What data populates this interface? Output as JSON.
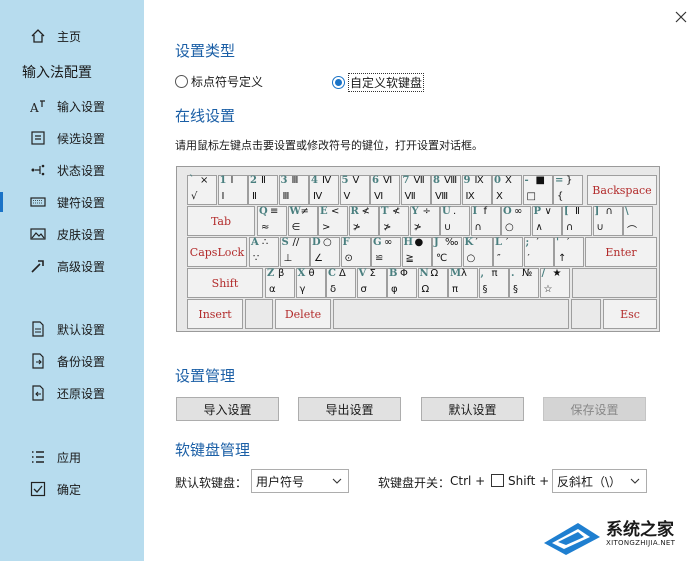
{
  "sidebar": {
    "home": "主页",
    "heading": "输入法配置",
    "items": [
      {
        "label": "输入设置",
        "icon": "input-settings-icon"
      },
      {
        "label": "候选设置",
        "icon": "candidate-icon"
      },
      {
        "label": "状态设置",
        "icon": "status-icon"
      },
      {
        "label": "键符设置",
        "icon": "keyboard-icon"
      },
      {
        "label": "皮肤设置",
        "icon": "image-icon"
      },
      {
        "label": "高级设置",
        "icon": "wrench-icon"
      },
      {
        "label": "默认设置",
        "icon": "document-icon"
      },
      {
        "label": "备份设置",
        "icon": "backup-icon"
      },
      {
        "label": "还原设置",
        "icon": "restore-icon"
      },
      {
        "label": "应用",
        "icon": "list-icon"
      },
      {
        "label": "确定",
        "icon": "checkbox-icon"
      }
    ],
    "active_index": 3,
    "accent": "#1a73c7",
    "background": "#b7dcee"
  },
  "settings_type": {
    "title": "设置类型",
    "option_punct": "标点符号定义",
    "option_custom": "自定义软键盘",
    "selected": "自定义软键盘"
  },
  "online": {
    "title": "在线设置",
    "description": "请用鼠标左键点击要设置或修改符号的键位，打开设置对话框。"
  },
  "keyboard": {
    "fn_color": "#b22b2b",
    "code_color": "#4a7f7f",
    "row1": [
      {
        "c": "`",
        "a": "×",
        "b": "√"
      },
      {
        "c": "1",
        "a": "Ⅰ",
        "b": "Ⅰ"
      },
      {
        "c": "2",
        "a": "Ⅱ",
        "b": "Ⅱ"
      },
      {
        "c": "3",
        "a": "Ⅲ",
        "b": "Ⅲ"
      },
      {
        "c": "4",
        "a": "Ⅳ",
        "b": "Ⅳ"
      },
      {
        "c": "5",
        "a": "Ⅴ",
        "b": "Ⅴ"
      },
      {
        "c": "6",
        "a": "Ⅵ",
        "b": "Ⅵ"
      },
      {
        "c": "7",
        "a": "Ⅶ",
        "b": "Ⅶ"
      },
      {
        "c": "8",
        "a": "Ⅷ",
        "b": "Ⅷ"
      },
      {
        "c": "9",
        "a": "Ⅸ",
        "b": "Ⅸ"
      },
      {
        "c": "0",
        "a": "Ⅹ",
        "b": "Ⅹ"
      },
      {
        "c": "-",
        "a": "■",
        "b": "□"
      },
      {
        "c": "=",
        "a": "}",
        "b": "{"
      }
    ],
    "row2": [
      {
        "c": "Q",
        "a": "≡",
        "b": "≈"
      },
      {
        "c": "W",
        "a": "≠",
        "b": "∈"
      },
      {
        "c": "E",
        "a": "<",
        "b": ">"
      },
      {
        "c": "R",
        "a": "≮",
        "b": "≯"
      },
      {
        "c": "T",
        "a": "≮",
        "b": "≯"
      },
      {
        "c": "Y",
        "a": "÷",
        "b": "≯"
      },
      {
        "c": "U",
        "a": ".",
        "b": "∪"
      },
      {
        "c": "I",
        "a": "f",
        "b": "∩"
      },
      {
        "c": "O",
        "a": "∞",
        "b": "○"
      },
      {
        "c": "P",
        "a": "∨",
        "b": "∧"
      },
      {
        "c": "[",
        "a": "Ⅱ",
        "b": "∩"
      },
      {
        "c": "]",
        "a": "∩",
        "b": "∪"
      },
      {
        "c": "\\",
        "a": "",
        "b": "⌒"
      }
    ],
    "row3": [
      {
        "c": "A",
        "a": "∴",
        "b": "∵"
      },
      {
        "c": "S",
        "a": "//",
        "b": "⊥"
      },
      {
        "c": "D",
        "a": "○",
        "b": "∠"
      },
      {
        "c": "F",
        "a": "",
        "b": "⊙"
      },
      {
        "c": "G",
        "a": "∞",
        "b": "≌"
      },
      {
        "c": "H",
        "a": "●",
        "b": "≧"
      },
      {
        "c": "J",
        "a": "‰",
        "b": "℃"
      },
      {
        "c": "K",
        "a": "′",
        "b": "○"
      },
      {
        "c": "L",
        "a": "′",
        "b": "″"
      },
      {
        "c": ";",
        "a": "′",
        "b": "′"
      },
      {
        "c": "'",
        "a": "′",
        "b": "↑"
      }
    ],
    "row4": [
      {
        "c": "Z",
        "a": "β",
        "b": "α"
      },
      {
        "c": "X",
        "a": "θ",
        "b": "γ"
      },
      {
        "c": "C",
        "a": "Δ",
        "b": "δ"
      },
      {
        "c": "V",
        "a": "Σ",
        "b": "σ"
      },
      {
        "c": "B",
        "a": "Φ",
        "b": "φ"
      },
      {
        "c": "N",
        "a": "Ω",
        "b": "Ω"
      },
      {
        "c": "M",
        "a": "λ",
        "b": "π"
      },
      {
        "c": ",",
        "a": "π",
        "b": "§"
      },
      {
        "c": ".",
        "a": "№",
        "b": "§"
      },
      {
        "c": "/",
        "a": "★",
        "b": "☆"
      }
    ],
    "keys": {
      "backspace": "Backspace",
      "tab": "Tab",
      "capslock": "CapsLock",
      "enter": "Enter",
      "shift": "Shift",
      "insert": "Insert",
      "delete": "Delete",
      "esc": "Esc"
    }
  },
  "management": {
    "title": "设置管理",
    "import": "导入设置",
    "export": "导出设置",
    "default": "默认设置",
    "save": "保存设置"
  },
  "softkb": {
    "title": "软键盘管理",
    "default_label": "默认软键盘：",
    "default_value": "用户符号",
    "toggle_label": "软键盘开关：",
    "ctrl": "Ctrl +",
    "shift": "Shift +",
    "key_value": "反斜杠（\\）"
  },
  "watermark": {
    "text": "系统之家",
    "sub": "XITONGZHIJIA.NET"
  }
}
